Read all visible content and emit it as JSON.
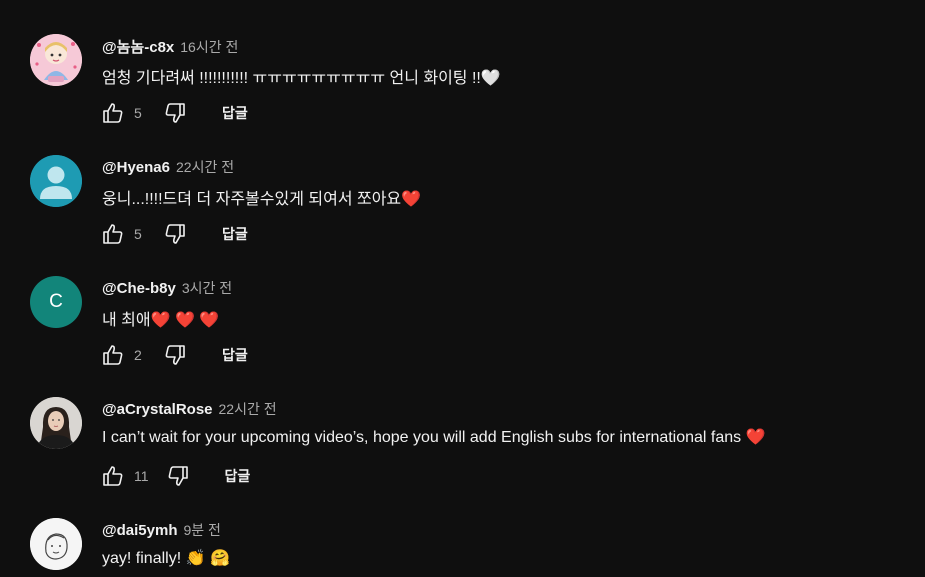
{
  "comments": [
    {
      "author": "@놈놈-c8x",
      "time": "16시간 전",
      "text": "엄청 기다려써 !!!!!!!!!!! ㅠㅠㅠㅠㅠㅠㅠㅠㅠ 언니 화이팅 !!🤍",
      "likes": "5",
      "reply_label": "답글",
      "avatar": {
        "type": "illustration",
        "icon": "cartoon-girl-avatar",
        "bg": "#f6c9d7"
      }
    },
    {
      "author": "@Hyena6",
      "time": "22시간 전",
      "text": "웅니...!!!!드뎌 더 자주볼수있게 되여서 쪼아요❤️",
      "likes": "5",
      "reply_label": "답글",
      "avatar": {
        "type": "default",
        "icon": "default-person-avatar",
        "bg": "#1e9bb3"
      }
    },
    {
      "author": "@Che-b8y",
      "time": "3시간 전",
      "text": "내 최애❤️ ❤️ ❤️",
      "likes": "2",
      "reply_label": "답글",
      "avatar": {
        "type": "letter",
        "letter": "C",
        "bg": "#12857a"
      }
    },
    {
      "author": "@aCrystalRose",
      "time": "22시간 전",
      "text": "I can’t wait for your upcoming video’s, hope you will add English subs for international fans  ❤️",
      "likes": "11",
      "reply_label": "답글",
      "avatar": {
        "type": "photo",
        "icon": "woman-portrait-avatar",
        "bg": "#d9d6d2"
      }
    },
    {
      "author": "@dai5ymh",
      "time": "9분 전",
      "text": "yay! finally!  👏 🤗",
      "avatar": {
        "type": "sketch",
        "icon": "sketch-face-avatar",
        "bg": "#f5f5f5"
      }
    }
  ]
}
